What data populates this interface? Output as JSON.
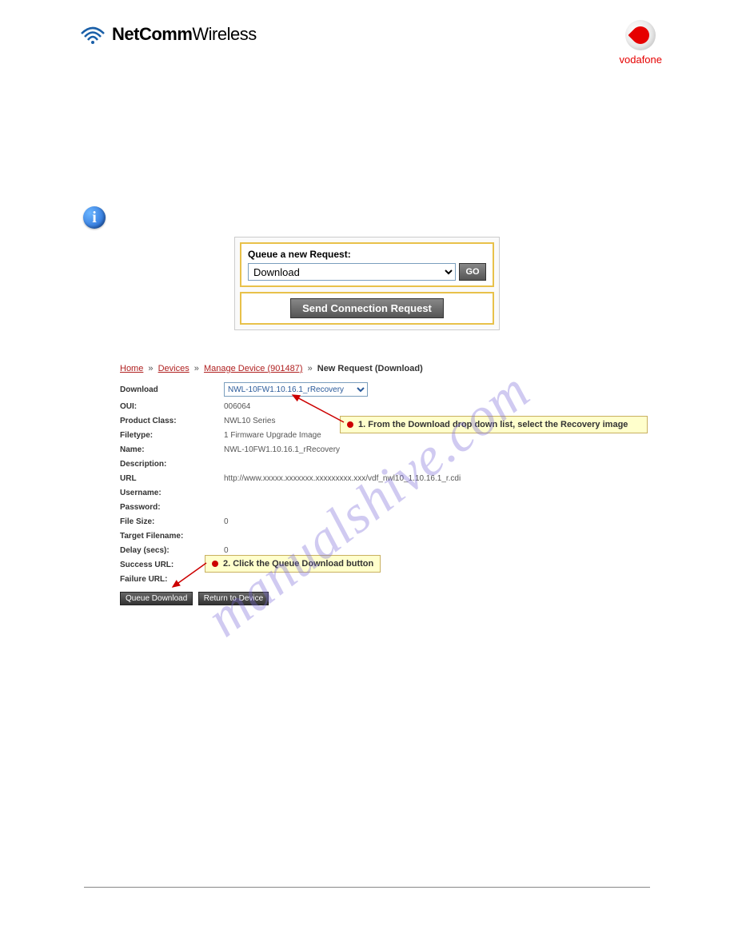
{
  "header": {
    "brand_bold": "NetComm",
    "brand_light": "Wireless",
    "vodafone": "vodafone"
  },
  "info_glyph": "i",
  "queue": {
    "label": "Queue a new Request:",
    "selected": "Download",
    "go": "GO",
    "send": "Send Connection Request"
  },
  "breadcrumb": {
    "home": "Home",
    "devices": "Devices",
    "manage": "Manage Device (901487)",
    "current": "New Request (Download)"
  },
  "form": {
    "download_label": "Download",
    "download_value": "NWL-10FW1.10.16.1_rRecovery",
    "rows": [
      {
        "label": "OUI:",
        "value": "006064"
      },
      {
        "label": "Product Class:",
        "value": "NWL10 Series"
      },
      {
        "label": "Filetype:",
        "value": "1 Firmware Upgrade Image"
      },
      {
        "label": "Name:",
        "value": "NWL-10FW1.10.16.1_rRecovery"
      },
      {
        "label": "Description:",
        "value": ""
      },
      {
        "label": "URL",
        "value": "http://www.xxxxx.xxxxxxx.xxxxxxxxx.xxx/vdf_nwl10_1.10.16.1_r.cdi"
      },
      {
        "label": "Username:",
        "value": ""
      },
      {
        "label": "Password:",
        "value": ""
      },
      {
        "label": "File Size:",
        "value": "0"
      },
      {
        "label": "Target Filename:",
        "value": ""
      },
      {
        "label": "Delay (secs):",
        "value": "0"
      },
      {
        "label": "Success URL:",
        "value": ""
      },
      {
        "label": "Failure URL:",
        "value": ""
      }
    ],
    "queue_btn": "Queue Download",
    "return_btn": "Return to Device"
  },
  "callouts": {
    "c1": "1. From the Download drop down list, select the Recovery image",
    "c2": "2. Click the Queue Download button"
  },
  "watermark": "manualshive.com"
}
